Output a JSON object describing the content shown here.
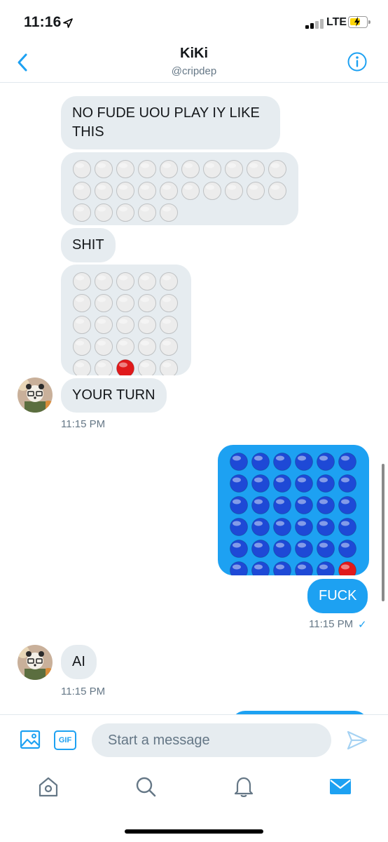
{
  "status_bar": {
    "time": "11:16",
    "network": "LTE",
    "icons": [
      "location-arrow-icon",
      "signal-bars-icon",
      "battery-charging-icon"
    ]
  },
  "header": {
    "title": "KiKi",
    "handle": "@cripdep",
    "icons": [
      "back-chevron-icon",
      "info-icon"
    ]
  },
  "colors": {
    "accent": "#1da1f2",
    "incoming_bubble": "#e6ecf0",
    "red_piece": "#e0191b",
    "blue_piece": "#1e49d6",
    "white_piece": "#ececec"
  },
  "messages": [
    {
      "direction": "in",
      "type": "text",
      "text": "NO FUDE UOU PLAY IY LIKE THIS"
    },
    {
      "direction": "in",
      "type": "emoji-grid",
      "rows": [
        "⚪⚪⚪⚪⚪⚪⚪⚪⚪⚪",
        "⚪⚪⚪⚪⚪⚪⚪⚪⚪⚪",
        "⚪⚪⚪⚪⚪"
      ]
    },
    {
      "direction": "in",
      "type": "text",
      "text": "SHIT"
    },
    {
      "direction": "in",
      "type": "emoji-grid",
      "rows": [
        "⚪⚪⚪⚪⚪",
        "⚪⚪⚪⚪⚪",
        "⚪⚪⚪⚪⚪",
        "⚪⚪⚪⚪⚪",
        "⚪⚪🔴⚪⚪"
      ]
    },
    {
      "direction": "in",
      "type": "text",
      "text": "YOUR TURN",
      "time": "11:15 PM"
    },
    {
      "direction": "out",
      "type": "emoji-grid",
      "rows": [
        "🔵🔵🔵🔵🔵🔵",
        "🔵🔵🔵🔵🔵🔵",
        "🔵🔵🔵🔵🔵🔵",
        "🔵🔵🔵🔵🔵🔵",
        "🔵🔵🔵🔵🔵🔵",
        "🔵🔵🔵🔵🔵🔴"
      ]
    },
    {
      "direction": "out",
      "type": "text",
      "text": "FUCK",
      "time": "11:15 PM",
      "read_mark": "✓"
    },
    {
      "direction": "in",
      "type": "text",
      "text": "AI",
      "time": "11:15 PM"
    }
  ],
  "composer": {
    "placeholder": "Start a message",
    "gif_label": "GIF",
    "icons": [
      "image-icon",
      "send-icon"
    ]
  },
  "tabbar": {
    "items": [
      "home-icon",
      "search-icon",
      "notifications-icon",
      "messages-icon"
    ],
    "active": "messages-icon"
  }
}
